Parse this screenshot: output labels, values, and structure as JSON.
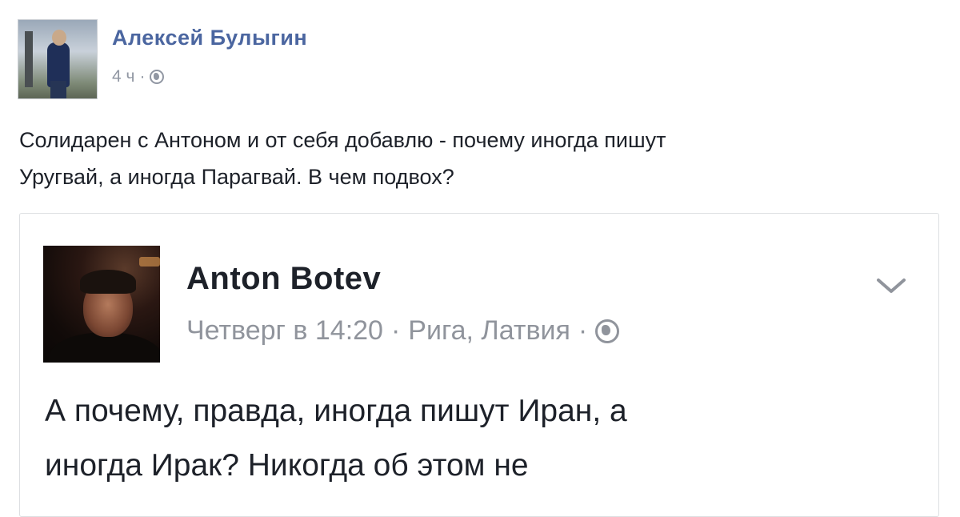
{
  "outer_post": {
    "author": "Алексей Булыгин",
    "time": "4 ч",
    "separator": "·",
    "privacy_icon": "globe-icon",
    "text_lines": [
      "Солидарен с Антоном и от себя добавлю - почему иногда пишут",
      "Уругвай, а иногда Парагвай. В чем подвох?"
    ]
  },
  "shared_post": {
    "author": "Anton  Botev",
    "time": "Четверг в 14:20",
    "separator": "·",
    "location": "Рига, Латвия",
    "privacy_icon": "globe-icon",
    "menu_icon": "chevron-down-icon",
    "text_lines": [
      "А почему, правда, иногда пишут Иран, а",
      "иногда Ирак? Никогда об этом не"
    ]
  },
  "colors": {
    "author_link": "#4b66a0",
    "meta_gray": "#9197a3",
    "text": "#1d2129",
    "card_border": "#dddfe2"
  }
}
